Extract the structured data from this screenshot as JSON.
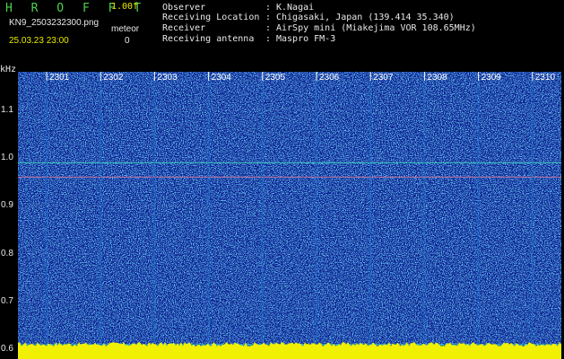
{
  "header": {
    "title": "H R O F F T",
    "version": "1.00f",
    "filename": "KN9_2503232300.png",
    "meteor_label": "meteor",
    "datetime": "25.03.23 23:00",
    "meteor_count": "0"
  },
  "info": [
    {
      "label": "Observer",
      "value": "K.Nagai"
    },
    {
      "label": "Receiving Location",
      "value": "Chigasaki, Japan (139.414 35.340)"
    },
    {
      "label": "Receiver",
      "value": "AirSpy mini (Miakejima VOR 108.65MHz)"
    },
    {
      "label": "Receiving antenna",
      "value": "Maspro FM-3"
    }
  ],
  "separator": ":",
  "axis": {
    "unit": "kHz",
    "y_ticks": [
      "1.1",
      "1.0",
      "0.9",
      "0.8",
      "0.7",
      "0.6"
    ],
    "x_ticks": [
      "2301",
      "2302",
      "2303",
      "2304",
      "2305",
      "2306",
      "2307",
      "2308",
      "2309",
      "2310"
    ]
  },
  "chart_data": {
    "type": "heatmap",
    "ylabel": "kHz",
    "ylim": [
      0.58,
      1.18
    ],
    "y_ticks": [
      1.1,
      1.0,
      0.9,
      0.8,
      0.7,
      0.6
    ],
    "x_tick_labels": [
      "2301",
      "2302",
      "2303",
      "2304",
      "2305",
      "2306",
      "2307",
      "2308",
      "2309",
      "2310"
    ],
    "carrier_lines_khz": [
      0.99,
      0.96,
      0.61
    ],
    "colors": {
      "background": "#0a1a8c",
      "noise": "#1f6fd0",
      "signal": "#3fe0c0",
      "baseline": "#f0f000",
      "grid": "#6a7ac8"
    }
  }
}
